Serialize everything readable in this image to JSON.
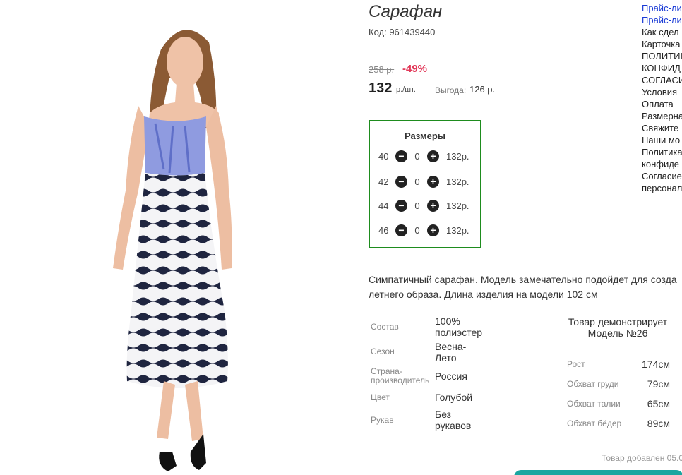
{
  "product": {
    "title": "Сарафан",
    "code": "Код: 961439440",
    "old_price": "258 р.",
    "discount": "-49%",
    "price": "132",
    "price_unit": "р./шт.",
    "savings_label": "Выгода:",
    "savings_value": "126 р."
  },
  "sizes": {
    "title": "Размеры",
    "minus_icon": "minus-icon",
    "plus_icon": "plus-icon",
    "rows": [
      {
        "size": "40",
        "qty": "0",
        "price": "132р."
      },
      {
        "size": "42",
        "qty": "0",
        "price": "132р."
      },
      {
        "size": "44",
        "qty": "0",
        "price": "132р."
      },
      {
        "size": "46",
        "qty": "0",
        "price": "132р."
      }
    ]
  },
  "description": {
    "line1": "Симпатичный сарафан. Модель замечательно подойдет для созда",
    "line2": "летнего образа. Длина изделия на модели 102 см"
  },
  "specs": [
    {
      "label": "Состав",
      "value_1": "100%",
      "value_2": "полиэстер"
    },
    {
      "label": "Сезон",
      "value_1": "Весна-",
      "value_2": "Лето"
    },
    {
      "label_1": "Страна-",
      "label_2": "производитель",
      "value_1": "Россия"
    },
    {
      "label": "Цвет",
      "value_1": "Голубой"
    },
    {
      "label": "Рукав",
      "value_1": "Без",
      "value_2": "рукавов"
    }
  ],
  "model": {
    "title_1": "Товар демонстрирует",
    "title_2": "Модель №26",
    "measurements": [
      {
        "label": "Рост",
        "value": "174см"
      },
      {
        "label": "Обхват груди",
        "value": "79см"
      },
      {
        "label": "Обхват талии",
        "value": "65см"
      },
      {
        "label": "Обхват бёдер",
        "value": "89см"
      }
    ]
  },
  "added_text": "Товар добавлен 05.0",
  "side_menu": [
    {
      "label": "Прайс-ли",
      "link": true
    },
    {
      "label": "Прайс-ли",
      "link": true
    },
    {
      "label": "Как сдел",
      "link": false
    },
    {
      "label": "Карточка",
      "link": false
    },
    {
      "label": "ПОЛИТИК",
      "link": false
    },
    {
      "label": "КОНФИД",
      "link": false
    },
    {
      "label": "СОГЛАСИ",
      "link": false
    },
    {
      "label": "Условия",
      "link": false
    },
    {
      "label": "Оплата",
      "link": false
    },
    {
      "label": "Размерна",
      "link": false
    },
    {
      "label": "Свяжите",
      "link": false
    },
    {
      "label": "Наши мо",
      "link": false
    },
    {
      "label": "Политика",
      "link": false
    },
    {
      "label": "конфиде",
      "link": false
    },
    {
      "label": "Согласие",
      "link": false
    },
    {
      "label": "персонал",
      "link": false
    }
  ],
  "colors": {
    "discount": "#e23b5b",
    "sizes_border": "#1e8c1e",
    "link": "#1a3bd6",
    "accent_button": "#1aa6a0"
  }
}
